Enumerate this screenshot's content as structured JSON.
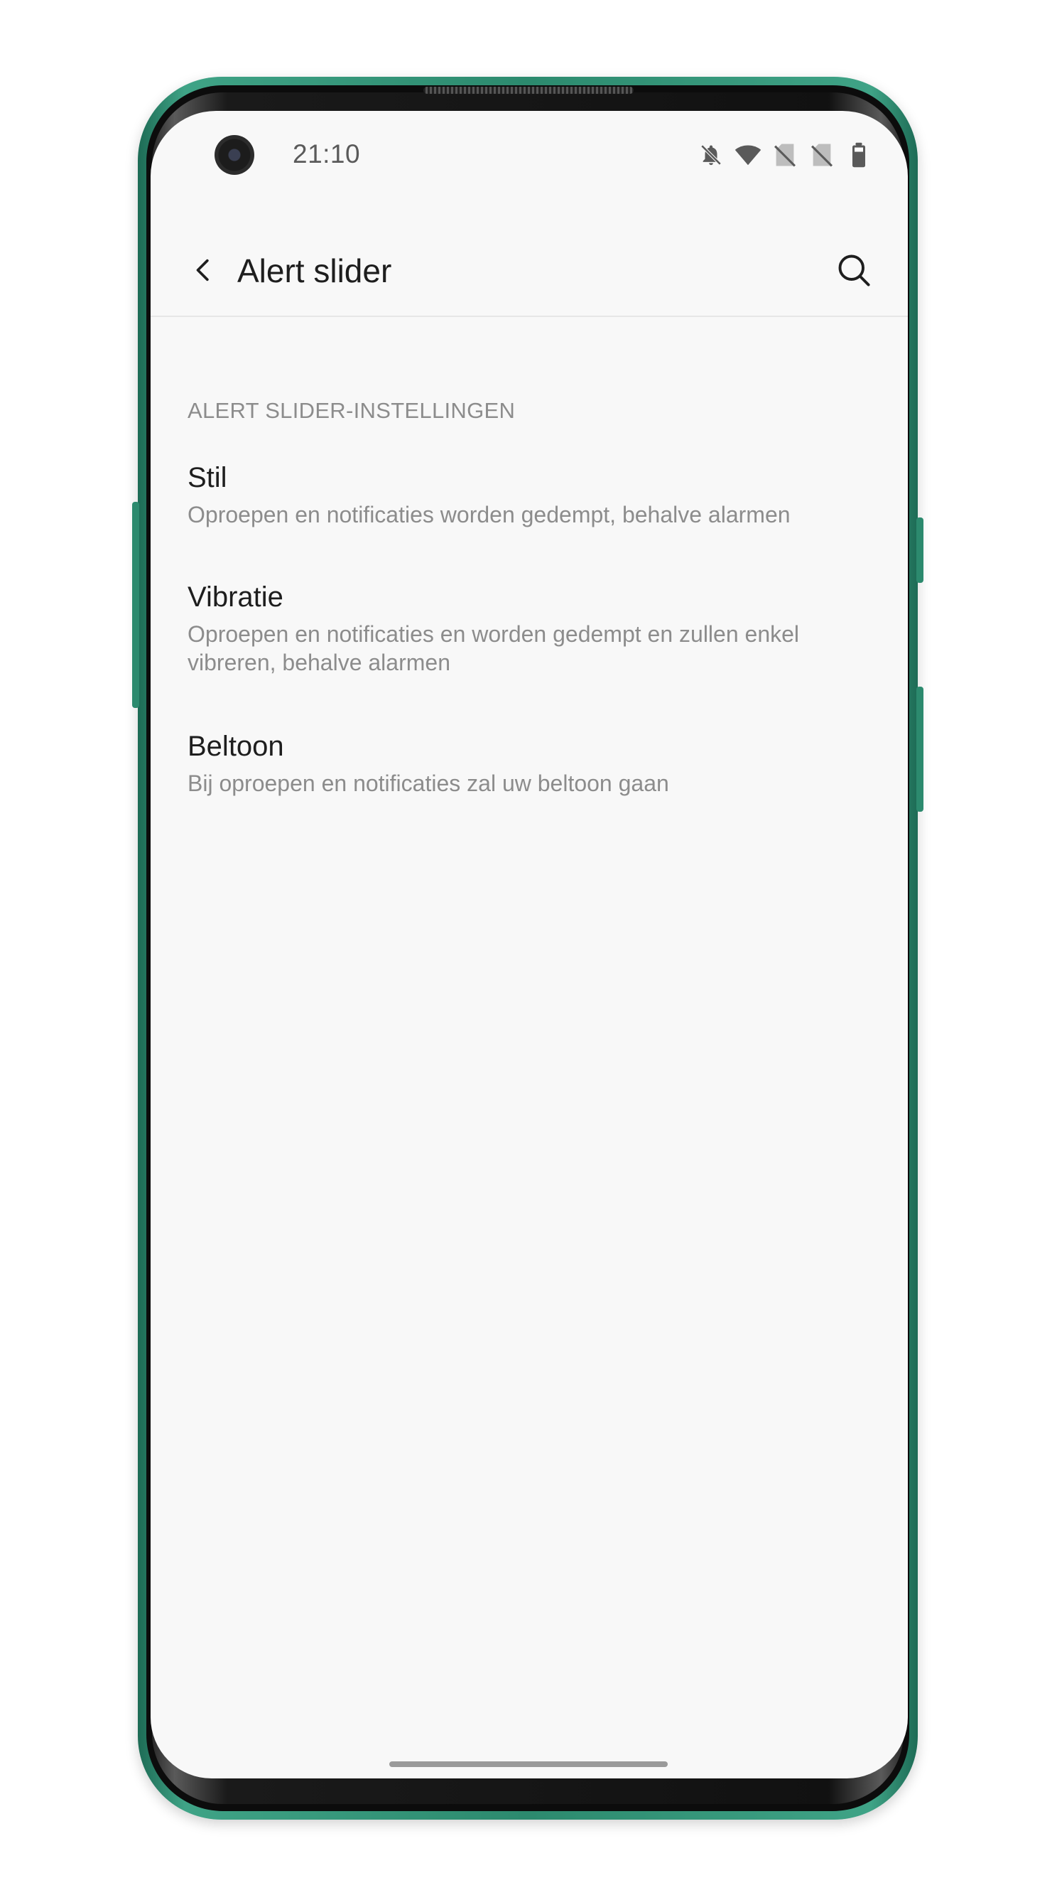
{
  "status_bar": {
    "time": "21:10",
    "icons": [
      "bell-off-icon",
      "wifi-icon",
      "no-sim-icon",
      "no-sim-icon",
      "battery-icon"
    ]
  },
  "app_bar": {
    "back_icon": "chevron-left-icon",
    "title": "Alert slider",
    "search_icon": "search-icon"
  },
  "section": {
    "header": "ALERT SLIDER-INSTELLINGEN",
    "items": [
      {
        "title": "Stil",
        "subtitle": "Oproepen en notificaties worden gedempt, behalve alarmen"
      },
      {
        "title": "Vibratie",
        "subtitle_line1": "Oproepen en notificaties en worden gedempt en zullen enkel",
        "subtitle_line2": "vibreren, behalve alarmen"
      },
      {
        "title": "Beltoon",
        "subtitle": "Bij oproepen en notificaties zal uw beltoon gaan"
      }
    ]
  },
  "colors": {
    "frame": "#2c8a6e",
    "screen_bg": "#f8f8f8",
    "primary_text": "#1e1e1e",
    "secondary_text": "#8c8c8c"
  }
}
